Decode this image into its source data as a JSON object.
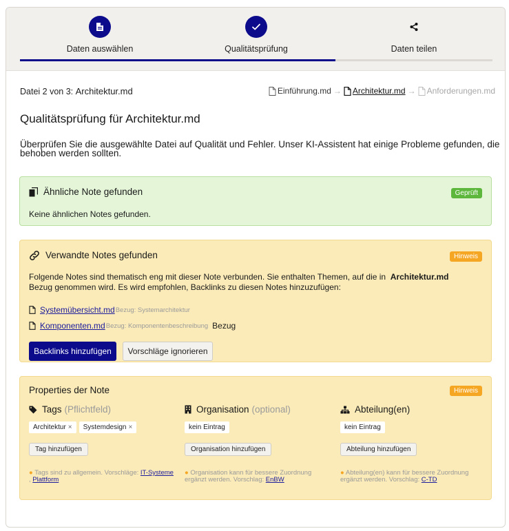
{
  "stepper": {
    "steps": [
      {
        "label": "Daten auswählen",
        "icon": "document-icon",
        "state": "done"
      },
      {
        "label": "Qualitätsprüfung",
        "icon": "check-icon",
        "state": "active"
      },
      {
        "label": "Daten teilen",
        "icon": "share-icon",
        "state": "pending"
      }
    ],
    "progress_fraction": 0.667
  },
  "file_info": {
    "prefix": "Datei 2 von 3:",
    "name": "Architektur.md"
  },
  "breadcrumb": [
    {
      "label": "Einführung.md",
      "state": "done"
    },
    {
      "label": "Architektur.md",
      "state": "active"
    },
    {
      "label": "Anforderungen.md",
      "state": "pending"
    }
  ],
  "heading": "Qualitätsprüfung für Architektur.md",
  "intro": "Überprüfen Sie die ausgewählte Datei auf Qualität und Fehler. Unser KI-Assistent hat einige Probleme gefunden, die behoben werden sollten.",
  "similar": {
    "title": "Ähnliche Note gefunden",
    "badge": "Geprüft",
    "text": "Keine ähnlichen Notes gefunden."
  },
  "related": {
    "title": "Verwandte Notes gefunden",
    "badge": "Hinweis",
    "text_before": "Folgende Notes sind thematisch eng mit dieser Note verbunden. Sie enthalten Themen, auf die in",
    "text_bold": "Architektur.md",
    "text_after": "Bezug genommen wird. Es wird empfohlen, Backlinks zu diesen Notes hinzuzufügen:",
    "notes": [
      {
        "link": "Systemübersicht.md",
        "ref": "Bezug: Systemarchitektur",
        "extra": ""
      },
      {
        "link": "Komponenten.md",
        "ref": "Bezug: Komponentenbeschreibung",
        "extra": "Bezug"
      }
    ],
    "primary_button": "Backlinks hinzufügen",
    "secondary_button": "Vorschläge ignorieren"
  },
  "properties": {
    "title": "Properties der Note",
    "badge": "Hinweis",
    "tags": {
      "label": "Tags",
      "qualifier": "(Pflichtfeld)",
      "chips": [
        "Architektur",
        "Systemdesign"
      ],
      "button": "Tag hinzufügen",
      "hint": "Tags sind zu allgemein. Vorschläge:",
      "suggestions": [
        "IT-Systeme",
        "Plattform"
      ]
    },
    "organisation": {
      "label": "Organisation",
      "qualifier": "(optional)",
      "value": "kein Eintrag",
      "button": "Organisation hinzufügen",
      "hint": "Organisation kann für bessere Zuordnung ergänzt werden. Vorschlag:",
      "suggestion": "EnBW"
    },
    "abteilung": {
      "label": "Abteilung(en)",
      "value": "kein Eintrag",
      "button": "Abteilung hinzufügen",
      "hint": "Abteilung(en) kann für bessere Zuordnung ergänzt werden. Vorschlag:",
      "suggestion": "C-TD"
    }
  },
  "colors": {
    "primary": "#0b0b8c",
    "success": "#5cb73c",
    "warning": "#f5a623",
    "success_bg": "#e4f5d8",
    "warning_bg": "#fbebb8"
  }
}
